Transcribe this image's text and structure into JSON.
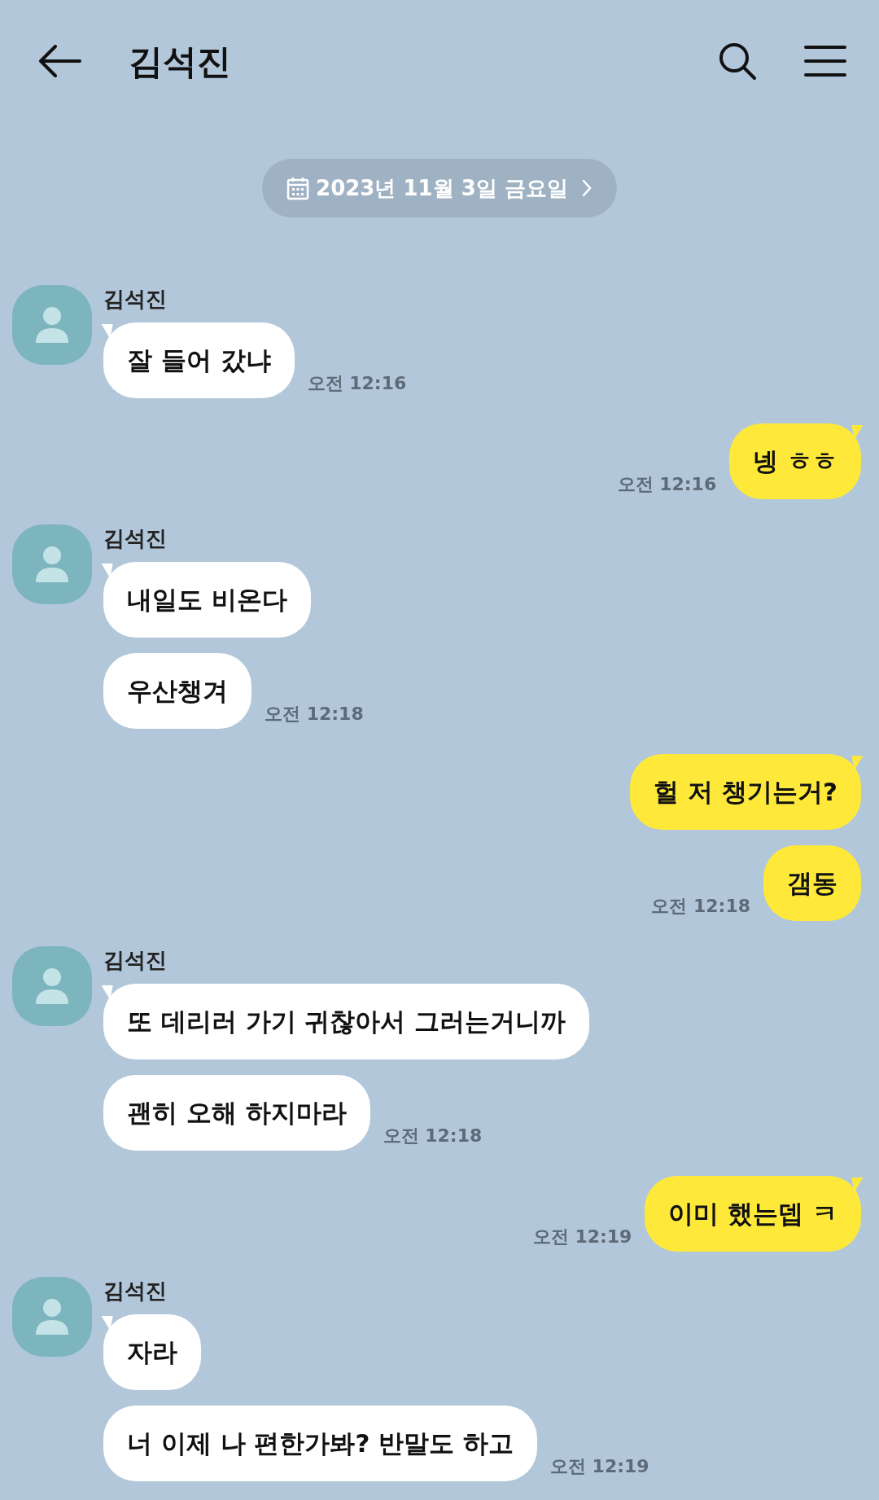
{
  "header": {
    "title": "김석진"
  },
  "date_pill": {
    "label": "2023년 11월 3일 금요일"
  },
  "messages": [
    {
      "kind": "received",
      "sender": "김석진",
      "bubbles": [
        "잘 들어 갔냐"
      ],
      "time": "오전 12:16"
    },
    {
      "kind": "sent",
      "bubbles": [
        "넹 ㅎㅎ"
      ],
      "time": "오전 12:16"
    },
    {
      "kind": "received",
      "sender": "김석진",
      "bubbles": [
        "내일도 비온다",
        "우산챙겨"
      ],
      "time": "오전 12:18"
    },
    {
      "kind": "sent",
      "bubbles": [
        "헐 저 챙기는거?",
        "갬동"
      ],
      "time": "오전 12:18"
    },
    {
      "kind": "received",
      "sender": "김석진",
      "bubbles": [
        "또 데리러 가기 귀찮아서 그러는거니까",
        "괜히 오해 하지마라"
      ],
      "time": "오전 12:18"
    },
    {
      "kind": "sent",
      "bubbles": [
        "이미 했는뎁 ㅋ"
      ],
      "time": "오전 12:19"
    },
    {
      "kind": "received",
      "sender": "김석진",
      "bubbles": [
        "자라",
        "너 이제 나 편한가봐? 반말도 하고"
      ],
      "time": "오전 12:19"
    }
  ]
}
